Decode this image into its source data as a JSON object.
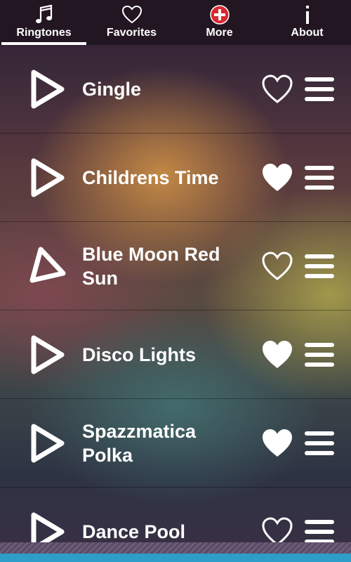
{
  "tabs": [
    {
      "label": "Ringtones",
      "icon": "music-note-icon",
      "active": true
    },
    {
      "label": "Favorites",
      "icon": "heart-outline-icon",
      "active": false
    },
    {
      "label": "More",
      "icon": "plus-circle-icon",
      "active": false
    },
    {
      "label": "About",
      "icon": "info-icon",
      "active": false
    }
  ],
  "ringtones": [
    {
      "title": "Gingle",
      "favorite": false
    },
    {
      "title": "Childrens Time",
      "favorite": true
    },
    {
      "title": "Blue Moon Red Sun",
      "favorite": false
    },
    {
      "title": "Disco Lights",
      "favorite": true
    },
    {
      "title": "Spazzmatica Polka",
      "favorite": true
    },
    {
      "title": "Dance Pool",
      "favorite": false
    }
  ],
  "colors": {
    "accent_bar": "#2d9ec9",
    "more_icon": "#d9282f",
    "tabbar_bg": "#221622"
  }
}
